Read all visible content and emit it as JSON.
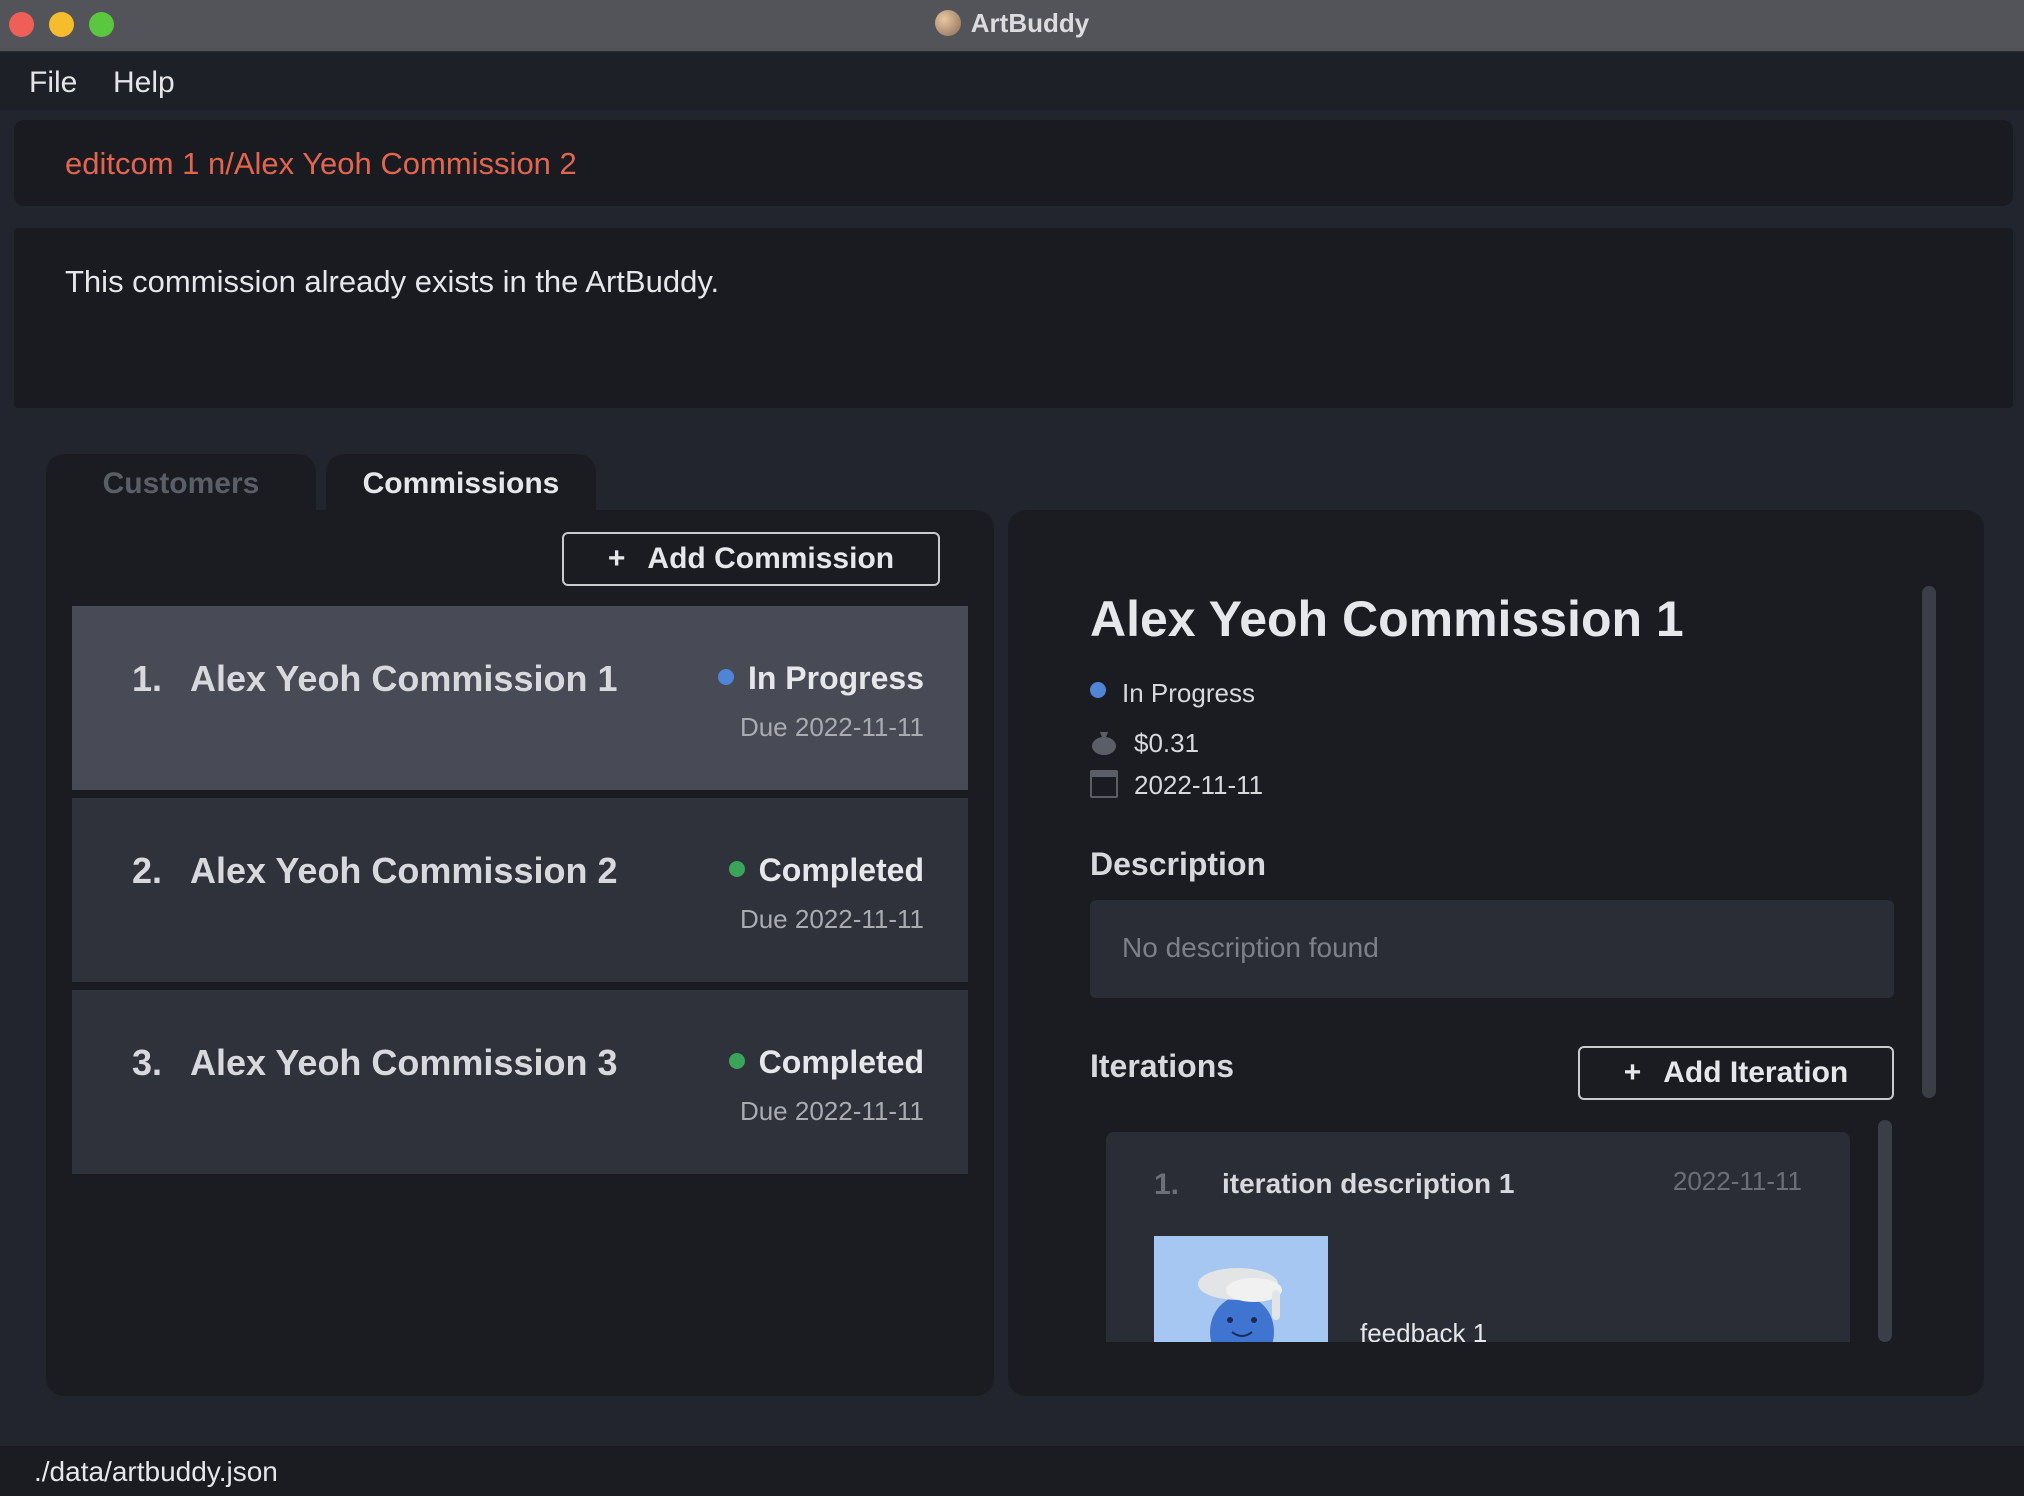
{
  "window": {
    "title": "ArtBuddy",
    "icon": "palette-icon"
  },
  "menu": {
    "items": [
      "File",
      "Help"
    ]
  },
  "command": {
    "text": "editcom 1 n/Alex Yeoh Commission 2",
    "color": "#e4654e"
  },
  "result": {
    "text": "This commission already exists in the ArtBuddy."
  },
  "tabs": [
    {
      "label": "Customers",
      "active": false
    },
    {
      "label": "Commissions",
      "active": true
    }
  ],
  "commissions_panel": {
    "add_button_label": "Add Commission",
    "plus": "+",
    "items": [
      {
        "index": "1.",
        "name": "Alex Yeoh Commission 1",
        "status": "In Progress",
        "status_color": "#4f84d6",
        "due": "Due 2022-11-11",
        "selected": true
      },
      {
        "index": "2.",
        "name": "Alex Yeoh Commission 2",
        "status": "Completed",
        "status_color": "#3aa55a",
        "due": "Due 2022-11-11",
        "selected": false
      },
      {
        "index": "3.",
        "name": "Alex Yeoh Commission 3",
        "status": "Completed",
        "status_color": "#3aa55a",
        "due": "Due 2022-11-11",
        "selected": false
      }
    ]
  },
  "detail": {
    "title": "Alex Yeoh Commission 1",
    "status": "In Progress",
    "status_color": "#4f84d6",
    "price": "$0.31",
    "price_icon": "money-bag-icon",
    "date": "2022-11-11",
    "date_icon": "calendar-icon",
    "description_label": "Description",
    "description_placeholder": "No description found",
    "iterations_label": "Iterations",
    "add_iteration_label": "Add Iteration",
    "plus": "+",
    "iterations": [
      {
        "index": "1.",
        "description": "iteration description 1",
        "date": "2022-11-11",
        "feedback": "feedback 1",
        "image": "avatar-illustration"
      }
    ]
  },
  "status_bar": {
    "path": "./data/artbuddy.json"
  }
}
